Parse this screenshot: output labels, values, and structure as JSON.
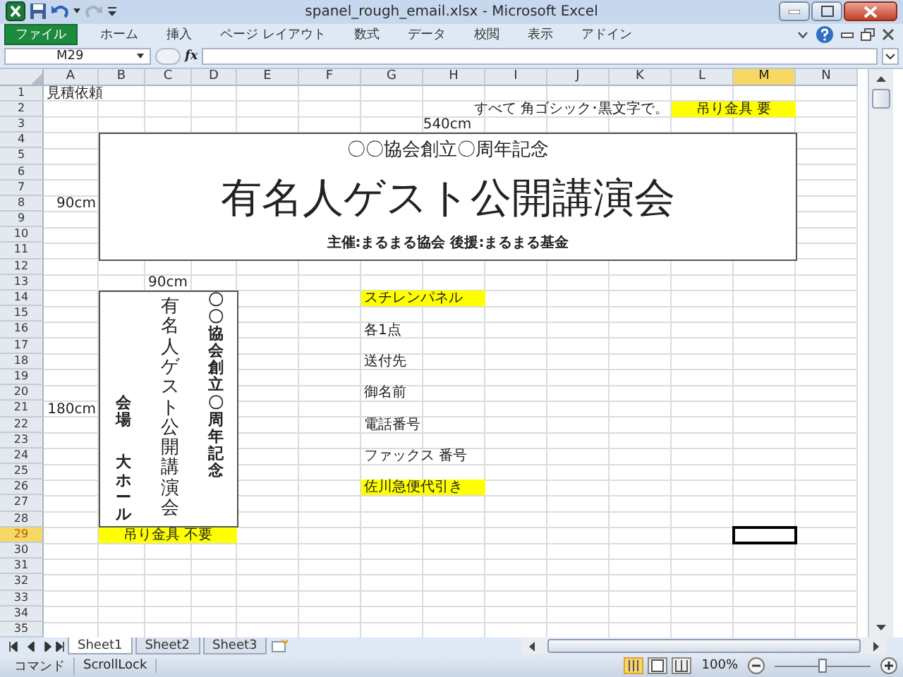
{
  "window": {
    "title": "spanel_rough_email.xlsx - Microsoft Excel"
  },
  "file_tab": "ファイル",
  "ribbon_tabs": [
    "ホーム",
    "挿入",
    "ページ レイアウト",
    "数式",
    "データ",
    "校閲",
    "表示",
    "アドイン"
  ],
  "name_box": "M29",
  "function_label": "fx",
  "columns": [
    {
      "label": "A",
      "selected": false
    },
    {
      "label": "B",
      "selected": false
    },
    {
      "label": "C",
      "selected": false
    },
    {
      "label": "D",
      "selected": false
    },
    {
      "label": "E",
      "selected": false
    },
    {
      "label": "F",
      "selected": false
    },
    {
      "label": "G",
      "selected": false
    },
    {
      "label": "H",
      "selected": false
    },
    {
      "label": "I",
      "selected": false
    },
    {
      "label": "J",
      "selected": false
    },
    {
      "label": "K",
      "selected": false
    },
    {
      "label": "L",
      "selected": false
    },
    {
      "label": "M",
      "selected": true
    },
    {
      "label": "N",
      "selected": false
    }
  ],
  "rows": [
    {
      "label": "1",
      "selected": false
    },
    {
      "label": "2",
      "selected": false
    },
    {
      "label": "3",
      "selected": false
    },
    {
      "label": "4",
      "selected": false
    },
    {
      "label": "5",
      "selected": false
    },
    {
      "label": "6",
      "selected": false
    },
    {
      "label": "7",
      "selected": false
    },
    {
      "label": "8",
      "selected": false
    },
    {
      "label": "9",
      "selected": false
    },
    {
      "label": "10",
      "selected": false
    },
    {
      "label": "11",
      "selected": false
    },
    {
      "label": "12",
      "selected": false
    },
    {
      "label": "13",
      "selected": false
    },
    {
      "label": "14",
      "selected": false
    },
    {
      "label": "15",
      "selected": false
    },
    {
      "label": "16",
      "selected": false
    },
    {
      "label": "17",
      "selected": false
    },
    {
      "label": "18",
      "selected": false
    },
    {
      "label": "19",
      "selected": false
    },
    {
      "label": "20",
      "selected": false
    },
    {
      "label": "21",
      "selected": false
    },
    {
      "label": "22",
      "selected": false
    },
    {
      "label": "23",
      "selected": false
    },
    {
      "label": "24",
      "selected": false
    },
    {
      "label": "25",
      "selected": false
    },
    {
      "label": "26",
      "selected": false
    },
    {
      "label": "27",
      "selected": false
    },
    {
      "label": "28",
      "selected": false
    },
    {
      "label": "29",
      "selected": true
    },
    {
      "label": "30",
      "selected": false
    },
    {
      "label": "31",
      "selected": false
    },
    {
      "label": "32",
      "selected": false
    },
    {
      "label": "33",
      "selected": false
    },
    {
      "label": "34",
      "selected": false
    },
    {
      "label": "35",
      "selected": false
    }
  ],
  "cells": [
    {
      "kind": "left",
      "text": "見積依頼",
      "highlighted": false
    },
    {
      "kind": "right",
      "text": "すべて 角ゴシック･黒文字で。",
      "highlighted": false
    },
    {
      "kind": "center",
      "text": "吊り金具 要",
      "highlighted": true
    },
    {
      "kind": "center",
      "text": "540cm",
      "highlighted": false
    },
    {
      "kind": "right",
      "text": "90cm",
      "highlighted": false
    },
    {
      "kind": "center",
      "text": "90cm",
      "highlighted": false
    },
    {
      "kind": "right",
      "text": "180cm",
      "highlighted": false
    },
    {
      "kind": "center",
      "text": "吊り金具 不要",
      "highlighted": true
    },
    {
      "kind": "left",
      "text": "スチレンパネル",
      "highlighted": true
    },
    {
      "kind": "left",
      "text": "各1点",
      "highlighted": false
    },
    {
      "kind": "left",
      "text": "送付先",
      "highlighted": false
    },
    {
      "kind": "left",
      "text": "御名前",
      "highlighted": false
    },
    {
      "kind": "left",
      "text": "電話番号",
      "highlighted": false
    },
    {
      "kind": "left",
      "text": "ファックス 番号",
      "highlighted": false
    },
    {
      "kind": "left",
      "text": "佐川急便代引き",
      "highlighted": true
    }
  ],
  "banner": {
    "lines": [
      {
        "kind": "subtitle",
        "text": "〇〇協会創立〇周年記念"
      },
      {
        "kind": "title",
        "text": "有名人ゲスト公開講演会"
      },
      {
        "kind": "credits",
        "text": "主催:まるまる協会 後援:まるまる基金"
      }
    ]
  },
  "vertical_panel": {
    "columns": [
      {
        "kind": "venue",
        "texts": [
          "会場",
          "大ホール"
        ]
      },
      {
        "kind": "title",
        "texts": [
          "有名人ゲスト公開講演会"
        ]
      },
      {
        "kind": "subtitle",
        "texts": [
          "〇〇協会創立〇周年記念"
        ]
      }
    ]
  },
  "sheet_tabs": [
    {
      "label": "Sheet1",
      "selected": true
    },
    {
      "label": "Sheet2",
      "selected": false
    },
    {
      "label": "Sheet3",
      "selected": false
    }
  ],
  "status_bar": {
    "mode": "コマンド",
    "lock": "ScrollLock",
    "zoom": "100%",
    "zoom_slider": {
      "level": 0.5
    }
  }
}
